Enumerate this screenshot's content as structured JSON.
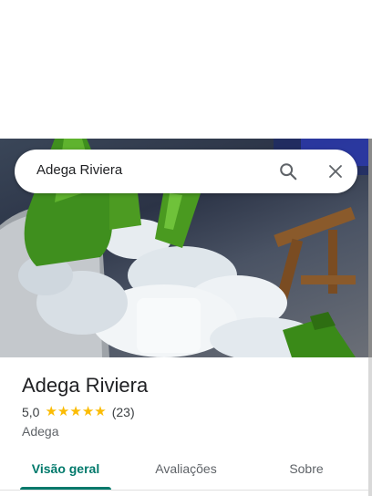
{
  "search": {
    "query": "Adega Riviera"
  },
  "place": {
    "name": "Adega Riviera",
    "rating": "5,0",
    "stars": 5,
    "review_count": "(23)",
    "category": "Adega"
  },
  "tabs": [
    {
      "label": "Visão geral",
      "active": true
    },
    {
      "label": "Avaliações",
      "active": false
    },
    {
      "label": "Sobre",
      "active": false
    }
  ],
  "colors": {
    "accent": "#00796b",
    "star": "#fbbc04"
  },
  "icons": {
    "search": "search-icon",
    "close": "close-icon",
    "star": "star-icon"
  }
}
